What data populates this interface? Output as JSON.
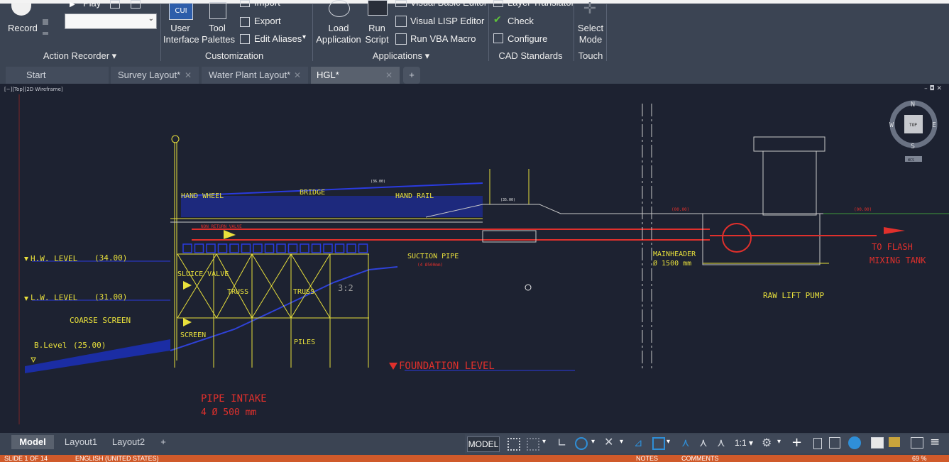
{
  "ribbon": {
    "record_label": "Record",
    "play_label": "Play",
    "import_label": "Import",
    "export_label": "Export",
    "edit_aliases_label": "Edit Aliases",
    "user_interface_label": "User\nInterface",
    "tool_palettes_label": "Tool\nPalettes",
    "load_application_label": "Load\nApplication",
    "run_script_label": "Run\nScript",
    "visual_basic_editor_label": "Visual Basic Editor",
    "visual_lisp_editor_label": "Visual LISP Editor",
    "run_vba_macro_label": "Run VBA Macro",
    "layer_translator_label": "Layer Translator",
    "check_label": "Check",
    "configure_label": "Configure",
    "select_mode_label": "Select\nMode",
    "groups": {
      "action_recorder": "Action Recorder",
      "customization": "Customization",
      "applications": "Applications",
      "cad_standards": "CAD Standards",
      "touch": "Touch"
    },
    "cui_badge": "CUI"
  },
  "tabs": [
    {
      "label": "Start"
    },
    {
      "label": "Survey Layout*"
    },
    {
      "label": "Water Plant Layout*"
    },
    {
      "label": "HGL*"
    }
  ],
  "viewport": {
    "label": "[−][Top][2D Wireframe]",
    "controls": "– ◘ ✕",
    "viewcube": {
      "top": "TOP",
      "n": "N",
      "s": "S",
      "e": "E",
      "w": "W",
      "wcs": "WCS"
    }
  },
  "drawing": {
    "hw_level": "H.W. LEVEL",
    "hw_value": "(34.00)",
    "lw_level": "L.W. LEVEL",
    "lw_value": "(31.00)",
    "coarse_screen": "COARSE SCREEN",
    "b_level": "B.Level",
    "b_value": "(25.00)",
    "hand_wheel": "HAND WHEEL",
    "bridge": "BRIDGE",
    "hand_rail": "HAND RAIL",
    "non_return_valve": "NON RETURN VALVE",
    "sluice_valve": "SLUICE VALVE",
    "truss1": "TRUSS",
    "truss2": "TRUSS",
    "screen": "SCREEN",
    "piles": "PILES",
    "slope": "3:2",
    "suction_pipe": "SUCTION PIPE",
    "suction_spec": "(4 Ø500mm)",
    "foundation_level": "FOUNDATION LEVEL",
    "pipe_intake": "PIPE INTAKE",
    "pipe_intake_spec": "4 Ø 500 mm",
    "mainheader": "MAINHEADER",
    "mainheader_spec": "Ø 1500 mm",
    "raw_lift_pump": "RAW LIFT PUMP",
    "to_flash": "TO FLASH",
    "mixing_tank": "MIXING TANK",
    "level_a": "(00.00)",
    "level_b": "(00.00)",
    "level_c": "(36.00)",
    "level_d": "(35.00)"
  },
  "layout_tabs": [
    {
      "label": "Model"
    },
    {
      "label": "Layout1"
    },
    {
      "label": "Layout2"
    }
  ],
  "status": {
    "model_label": "MODEL",
    "scale_label": "1:1"
  },
  "footer": {
    "slide": "SLIDE 1 OF 14",
    "language": "ENGLISH (UNITED STATES)",
    "notes": "NOTES",
    "comments": "COMMENTS",
    "zoom": "69 %"
  },
  "colors": {
    "ribbon_bg": "#3b4453",
    "canvas_bg": "#1d2231",
    "yellow": "#e8e03c",
    "red": "#e0302c",
    "blue": "#2a3be0",
    "status_orange": "#d05a2a"
  }
}
